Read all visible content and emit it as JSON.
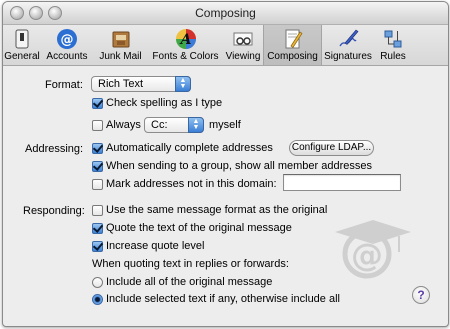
{
  "window": {
    "title": "Composing"
  },
  "toolbar": {
    "items": [
      {
        "label": "General",
        "icon": "general-switch-icon"
      },
      {
        "label": "Accounts",
        "icon": "at-sign-icon"
      },
      {
        "label": "Junk Mail",
        "icon": "junk-mail-icon"
      },
      {
        "label": "Fonts & Colors",
        "icon": "font-palette-icon"
      },
      {
        "label": "Viewing",
        "icon": "glasses-icon"
      },
      {
        "label": "Composing",
        "icon": "pencil-paper-icon"
      },
      {
        "label": "Signatures",
        "icon": "signature-pen-icon"
      },
      {
        "label": "Rules",
        "icon": "rules-icon"
      }
    ],
    "selected": "Composing"
  },
  "format": {
    "label": "Format:",
    "value": "Rich Text",
    "check_spelling": {
      "label": "Check spelling as I type",
      "checked": true
    },
    "always": {
      "label": "Always",
      "checked": false
    },
    "always_value": "Cc:",
    "always_suffix": "myself"
  },
  "addressing": {
    "label": "Addressing:",
    "auto_complete": {
      "label": "Automatically complete addresses",
      "checked": true
    },
    "configure_button": "Configure LDAP...",
    "show_all_members": {
      "label": "When sending to a group, show all member addresses",
      "checked": true
    },
    "mark_addresses": {
      "label": "Mark addresses not in this domain:",
      "checked": false
    },
    "domain_value": ""
  },
  "responding": {
    "label": "Responding:",
    "same_format": {
      "label": "Use the same message format as the original",
      "checked": false
    },
    "quote_text": {
      "label": "Quote the text of the original message",
      "checked": true
    },
    "increase_quote": {
      "label": "Increase quote level",
      "checked": true
    },
    "quoting_heading": "When quoting text in replies or forwards:",
    "include_all": {
      "label": "Include all of the original message",
      "selected": false
    },
    "include_selected": {
      "label": "Include selected text if any, otherwise include all",
      "selected": true
    }
  },
  "help_glyph": "?"
}
